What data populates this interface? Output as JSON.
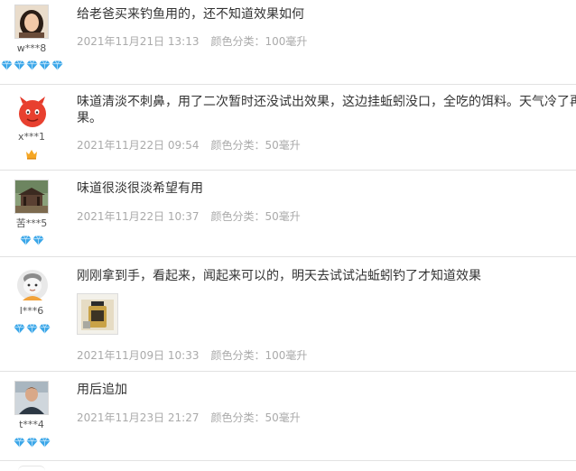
{
  "reviews": [
    {
      "username": "w***8",
      "avatar": "photo-avatar-woman",
      "badge_type": "diamond",
      "badge_count": 5,
      "text": "给老爸买来钓鱼用的，还不知道效果如何",
      "date": "2021年11月21日 13:13",
      "spec": "颜色分类：100毫升"
    },
    {
      "username": "x***1",
      "avatar": "devil-avatar",
      "badge_type": "crown",
      "badge_count": 1,
      "text": "味道清淡不刺鼻，用了二次暂时还没试出效果，这边挂蚯蚓没口，全吃的饵料。天气冷了再",
      "text_line2": "果。",
      "date": "2021年11月22日 09:54",
      "spec": "颜色分类：50毫升"
    },
    {
      "username": "苦***5",
      "avatar": "photo-avatar-pavilion",
      "badge_type": "diamond",
      "badge_count": 2,
      "text": "味道很淡很淡希望有用",
      "date": "2021年11月22日 10:37",
      "spec": "颜色分类：50毫升"
    },
    {
      "username": "l***6",
      "avatar": "default-cartoon-avatar",
      "badge_type": "diamond",
      "badge_count": 3,
      "text": "刚刚拿到手，看起来，闻起来可以的，明天去试试沾蚯蚓钓了才知道效果",
      "photo": "review-photo-bottle",
      "date": "2021年11月09日 10:33",
      "spec": "颜色分类：100毫升"
    },
    {
      "username": "t***4",
      "avatar": "photo-avatar-man",
      "badge_type": "diamond",
      "badge_count": 3,
      "text": "用后追加",
      "date": "2021年11月23日 21:27",
      "spec": "颜色分类：50毫升"
    }
  ],
  "colors": {
    "divider": "#e2e2e2",
    "meta_text": "#aaaaaa",
    "body_text": "#333333",
    "diamond": "#3aa6e8",
    "crown": "#f5a623"
  }
}
